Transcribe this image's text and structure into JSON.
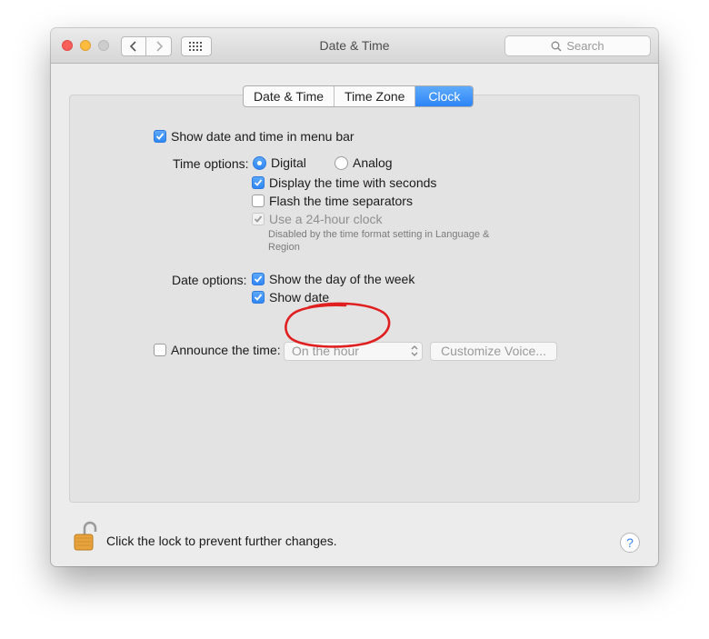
{
  "window": {
    "title": "Date & Time"
  },
  "search": {
    "placeholder": "Search"
  },
  "tabs": [
    {
      "label": "Date & Time",
      "selected": false
    },
    {
      "label": "Time Zone",
      "selected": false
    },
    {
      "label": "Clock",
      "selected": true
    }
  ],
  "clock": {
    "show_in_menu_bar": {
      "label": "Show date and time in menu bar",
      "checked": true
    },
    "time_options": {
      "label": "Time options:",
      "digital": {
        "label": "Digital",
        "selected": true
      },
      "analog": {
        "label": "Analog",
        "selected": false
      },
      "show_seconds": {
        "label": "Display the time with seconds",
        "checked": true
      },
      "flash_separators": {
        "label": "Flash the time separators",
        "checked": false
      },
      "use_24_hour": {
        "label": "Use a 24-hour clock",
        "checked": true,
        "disabled": true
      },
      "note": "Disabled by the time format setting in Language & Region"
    },
    "date_options": {
      "label": "Date options:",
      "show_day_of_week": {
        "label": "Show the day of the week",
        "checked": true
      },
      "show_date": {
        "label": "Show date",
        "checked": true
      }
    },
    "announce": {
      "label": "Announce the time:",
      "checked": false,
      "interval": "On the hour",
      "customize_button": "Customize Voice..."
    }
  },
  "footer": {
    "lock_message": "Click the lock to prevent further changes.",
    "help": "?"
  },
  "colors": {
    "accent": "#2f86f6",
    "annotation": "#e02020"
  }
}
